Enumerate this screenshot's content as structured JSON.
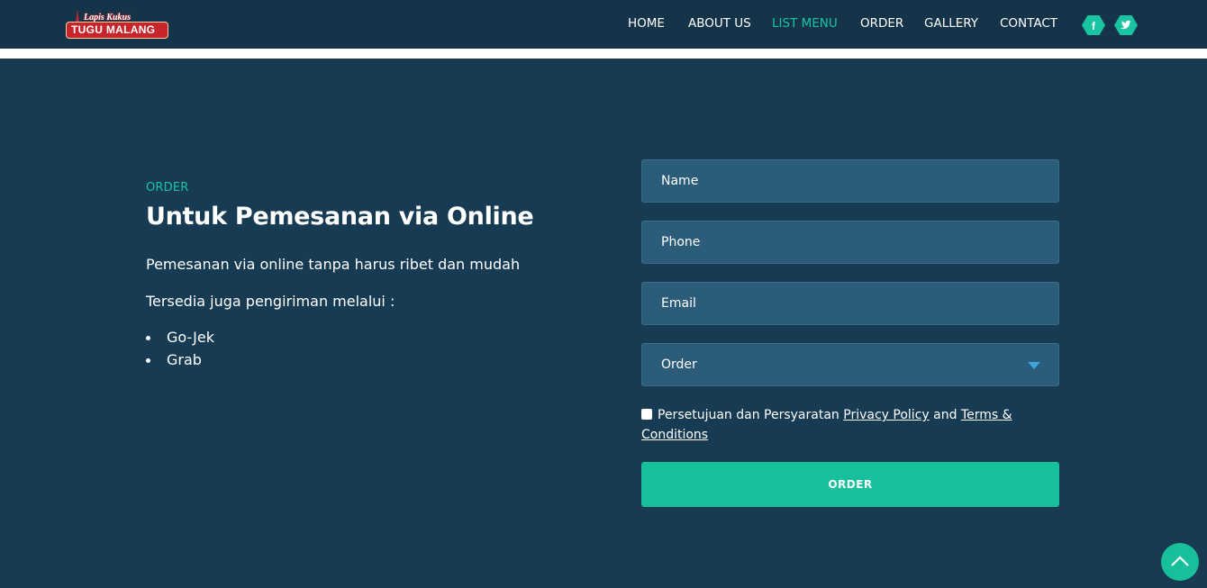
{
  "brand": {
    "logo_top": "Lapis Kukus",
    "logo_main": "TUGU MALANG"
  },
  "nav": {
    "items": [
      {
        "label": "HOME",
        "active": false
      },
      {
        "label": "ABOUT US",
        "active": false
      },
      {
        "label": "LIST MENU",
        "active": true
      },
      {
        "label": "ORDER",
        "active": false
      },
      {
        "label": "GALLERY",
        "active": false
      },
      {
        "label": "CONTACT",
        "active": false
      }
    ],
    "social": [
      {
        "icon": "facebook-icon",
        "glyph": "f"
      },
      {
        "icon": "twitter-icon",
        "glyph": "t"
      }
    ]
  },
  "section": {
    "tag": "ORDER",
    "title": "Untuk Pemesanan via Online",
    "paragraph1": "Pemesanan via online tanpa harus ribet dan mudah",
    "paragraph2": "Tersedia juga pengiriman melalui :",
    "delivery_options": [
      "Go-Jek",
      "Grab"
    ]
  },
  "form": {
    "name_placeholder": "Name",
    "phone_placeholder": "Phone",
    "email_placeholder": "Email",
    "order_select": "Order",
    "consent_text": "Persetujuan dan Persyaratan",
    "privacy_link": "Privacy Policy",
    "and_text": "and",
    "terms_link": "Terms & Conditions",
    "submit_label": "ORDER"
  },
  "colors": {
    "accent": "#17bf9b",
    "background": "#173b52",
    "navbar": "#153449",
    "field": "#2b5c7a"
  }
}
